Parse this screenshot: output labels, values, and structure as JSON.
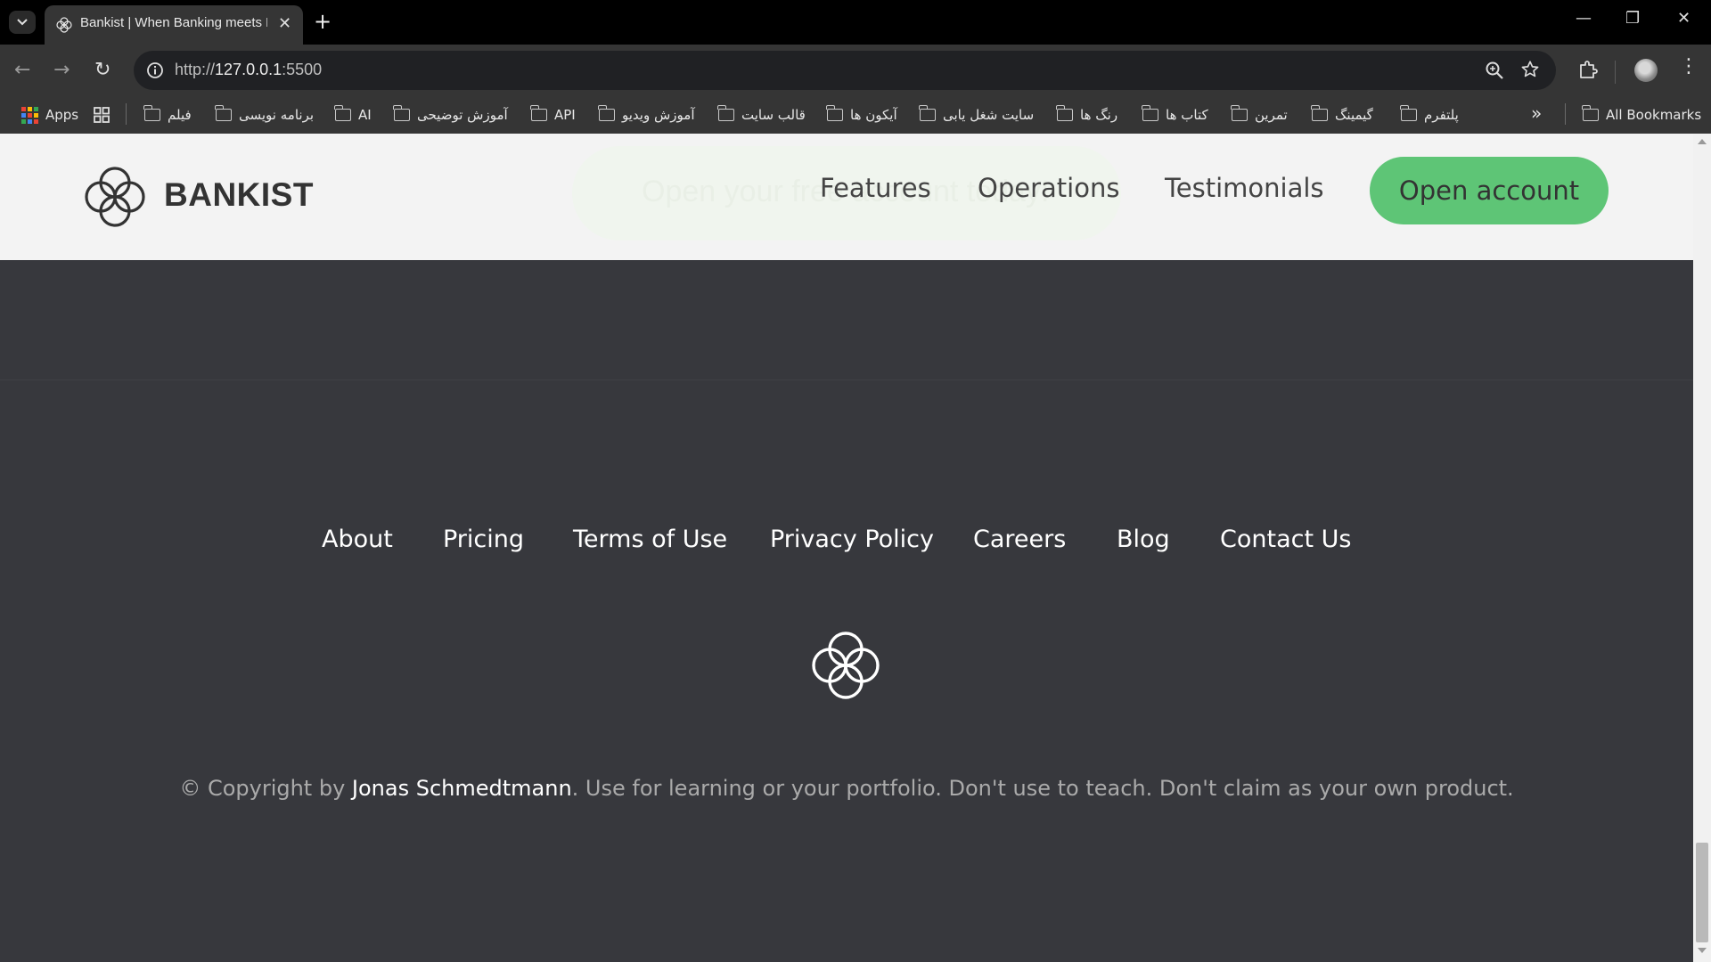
{
  "browser": {
    "tab_title": "Bankist | When Banking meets Minimalist",
    "url_scheme": "http://",
    "url_host": "127.0.0.1",
    "url_port": ":5500",
    "new_tab_symbol": "+",
    "close_symbol": "✕",
    "minimize_symbol": "—",
    "restore_symbol": "❐",
    "window_close_symbol": "✕",
    "menu_symbol": "⋮",
    "bookmarks_overflow": "»"
  },
  "bookmarks": {
    "apps_label": "Apps",
    "items": [
      "فیلم",
      "برنامه نویسی",
      "AI",
      "آموزش توضیحی",
      "API",
      "آموزش ویدیو",
      "قالب سایت",
      "آیکون ها",
      "سایت شغل یابی",
      "رنگ ها",
      "کتاب ها",
      "تمرین",
      "گیمینگ",
      "پلتفرم"
    ],
    "all_bookmarks": "All Bookmarks"
  },
  "nav": {
    "logo_text": "BANKIST",
    "ghost_text": "Open your free account today!",
    "links": [
      "Features",
      "Operations",
      "Testimonials"
    ],
    "cta_label": "Open account"
  },
  "footer": {
    "links": [
      "About",
      "Pricing",
      "Terms of Use",
      "Privacy Policy",
      "Careers",
      "Blog",
      "Contact Us"
    ],
    "copyright_prefix": "© Copyright by ",
    "copyright_author": "Jonas Schmedtmann",
    "copyright_suffix": ". Use for learning or your portfolio. Don't use to teach. Don't claim as your own product."
  },
  "colors": {
    "accent_green": "#5ec576",
    "footer_bg": "#37383d",
    "nav_bg": "#f3f3f3"
  },
  "icons": {
    "tab_search": "chevron-down-icon",
    "favicon": "bankist-logo-icon",
    "info": "info-icon",
    "zoom": "zoom-icon",
    "star": "bookmark-star-icon",
    "extensions": "puzzle-icon",
    "folder": "folder-icon",
    "apps": "apps-grid-icon",
    "tab_groups": "tab-groups-icon"
  }
}
